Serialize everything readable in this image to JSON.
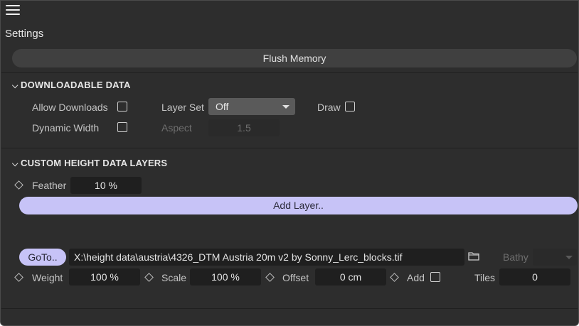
{
  "header": {
    "menu_icon": "hamburger-menu-icon",
    "title": "Settings"
  },
  "flush_button": "Flush Memory",
  "downloadable": {
    "heading": "DOWNLOADABLE DATA",
    "allow_downloads": {
      "label": "Allow Downloads",
      "checked": false
    },
    "layer_set": {
      "label": "Layer Set",
      "value": "Off"
    },
    "draw": {
      "label": "Draw",
      "checked": false
    },
    "dynamic_width": {
      "label": "Dynamic Width",
      "checked": false
    },
    "aspect": {
      "label": "Aspect",
      "value": "1.5",
      "disabled": true
    }
  },
  "custom_layers": {
    "heading": "CUSTOM HEIGHT DATA LAYERS",
    "feather": {
      "label": "Feather",
      "value": "10 %"
    },
    "add_layer": "Add Layer..",
    "layer": {
      "goto": "GoTo..",
      "path": "X:\\height data\\austria\\4326_DTM Austria 20m v2 by Sonny_Lerc_blocks.tif",
      "bathy": {
        "label": "Bathy",
        "value": "",
        "disabled": true
      },
      "weight": {
        "label": "Weight",
        "value": "100 %"
      },
      "scale": {
        "label": "Scale",
        "value": "100 %"
      },
      "offset": {
        "label": "Offset",
        "value": "0 cm"
      },
      "add": {
        "label": "Add",
        "checked": false
      },
      "tiles": {
        "label": "Tiles",
        "value": "0"
      }
    }
  },
  "colors": {
    "panel": "#2d2d2d",
    "accent_button": "#c7c3f7",
    "field": "#1f1f1f"
  }
}
